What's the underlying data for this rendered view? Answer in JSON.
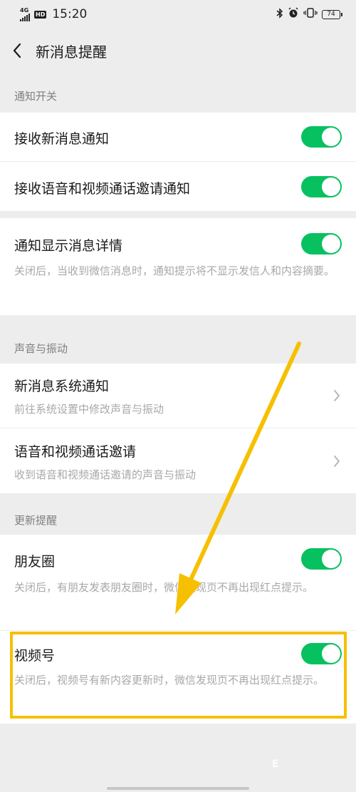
{
  "status_bar": {
    "network": "4G",
    "hd": "HD",
    "time": "15:20",
    "battery": "74"
  },
  "nav": {
    "title": "新消息提醒"
  },
  "sections": {
    "notify": {
      "header": "通知开关"
    },
    "sound": {
      "header": "声音与振动"
    },
    "update": {
      "header": "更新提醒"
    }
  },
  "rows": {
    "receive_new": {
      "label": "接收新消息通知",
      "enabled": true
    },
    "receive_call": {
      "label": "接收语音和视频通话邀请通知",
      "enabled": true
    },
    "show_detail": {
      "label": "通知显示消息详情",
      "description": "关闭后，当收到微信消息时，通知提示将不显示发信人和内容摘要。",
      "enabled": true
    },
    "system_notify": {
      "label": "新消息系统通知",
      "description": "前往系统设置中修改声音与振动"
    },
    "call_invite": {
      "label": "语音和视频通话邀请",
      "description": "收到语音和视频通话邀请的声音与振动"
    },
    "moments": {
      "label": "朋友圈",
      "description": "关闭后，有朋友发表朋友圈时，微信发现页不再出现红点提示。",
      "enabled": true
    },
    "channels": {
      "label": "视频号",
      "description": "关闭后，视频号有新内容更新时，微信发现页不再出现红点提示。",
      "enabled": true
    }
  },
  "annotation": {
    "color": "#f6c000"
  },
  "watermark": "E",
  "colors": {
    "accent": "#07c160",
    "background": "#ededed",
    "secondary_text": "#a8a8a8",
    "section_text": "#7f7f7f"
  }
}
